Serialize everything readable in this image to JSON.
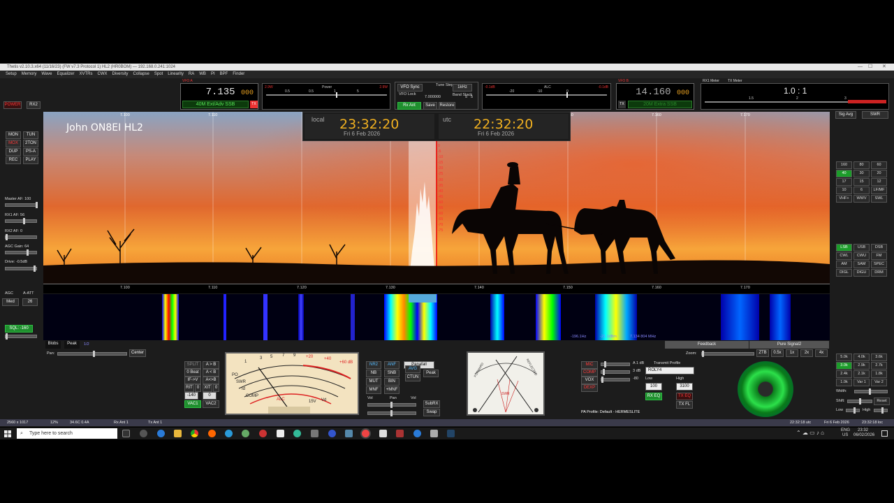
{
  "window": {
    "title": "Thetis v2.10.3.x64 (11/16/23) (FW v7.3 Protocol 1) HL2 (HR0BOM) — 192.168.0.241:1024"
  },
  "menu": [
    "Setup",
    "Memory",
    "Wave",
    "Equalizer",
    "XVTRs",
    "CWX",
    "Diversity",
    "Collapse",
    "Spot",
    "Linearity",
    "RA",
    "WB",
    "PI",
    "BPF",
    "Finder"
  ],
  "left_buttons": {
    "power": "POWER",
    "rx2": "RX2",
    "mon": "MON",
    "tun": "TUN",
    "mox": "MOX",
    "two_ton": "2TON",
    "dup": "DUP",
    "ps_a": "PS-A",
    "rec": "REC",
    "play": "PLAY"
  },
  "left_sliders": {
    "master_af": "Master AF: 100",
    "rx1_af": "RX1 AF: 56",
    "rx2_af": "RX2 AF: 0",
    "agc_gain": "AGC Gain: 64",
    "drive": "Drive: -0.5dB",
    "agc": "AGC",
    "a_att": "A-ATT",
    "agc_mode": "Med",
    "att": "26",
    "sql": "SQL: -160"
  },
  "vfo_a": {
    "label": "VFO A",
    "freq": "7.135",
    "freq_small": "000",
    "band": "40M Ext/Adv SSB",
    "tx": "TX"
  },
  "vfo_b": {
    "label": "VFO B",
    "freq": "14.160",
    "freq_small": "000",
    "band": "20M Extra SSB",
    "tx": "TX"
  },
  "power_meter": {
    "left": "2.9W",
    "title": "Power",
    "right": "2.9W",
    "scale": [
      "0.5",
      "0.5",
      "1",
      "5"
    ]
  },
  "alc_meter": {
    "left": "-0.1dB",
    "title": "ALC",
    "right": "-0.1dB",
    "scale": [
      "-20",
      "-10",
      "0"
    ]
  },
  "sync": {
    "vfo_sync": "VFO Sync",
    "vfo_lock": "VFO Lock",
    "tune_step": "Tune Step:",
    "step": "1kHz",
    "band_stack": "Band Stack",
    "stack_val": "7.000000",
    "rx_ant": "Rx Ant",
    "save": "Save",
    "restore": "Restore",
    "num": "5",
    "num2": "5"
  },
  "rx_meter": {
    "rx1": "RX1 Meter",
    "tx": "TX Meter",
    "value": "1.0 : 1",
    "scale": [
      "1.5",
      "2",
      "3"
    ],
    "sig_avg": "Sig Avg",
    "swr": "SWR"
  },
  "callsign": "John ON8EI HL2",
  "clocks": {
    "local_label": "local",
    "local_time": "23:32:20",
    "local_date": "Fri 6 Feb 2026",
    "utc_label": "utc",
    "utc_time": "22:32:20",
    "utc_date": "Fri 6 Feb 2026"
  },
  "freq_ticks_top": [
    "7.100",
    "7.110",
    "7.120",
    "7.130",
    "7.140",
    "7.150",
    "7.160",
    "7.170"
  ],
  "freq_ticks_bottom": [
    "7.100",
    "7.110",
    "7.120",
    "7.130",
    "7.140",
    "7.150",
    "7.160",
    "7.170"
  ],
  "db_scale": [
    "0",
    "-5",
    "-10",
    "-15",
    "-20",
    "-25",
    "-30",
    "-35",
    "-40",
    "-45",
    "-50",
    "-55",
    "-60",
    "-65",
    "-70",
    "-75"
  ],
  "wf_status": {
    "hz": "-196.1Hz",
    "dbm": "-21.1dBm",
    "mhz": "7.134 804 MHz"
  },
  "bottom_tabs": {
    "blobs": "Blobs",
    "peak": "Peak",
    "half": "1/2",
    "feedback": "Feedback",
    "pure": "Pure Signal2",
    "zoom": "Zoom:",
    "pan": "Pan:",
    "center": "Center"
  },
  "zoom_buttons": [
    "ZTB",
    "0.5x",
    "1x",
    "2x",
    "4x"
  ],
  "bands": [
    "160",
    "80",
    "60",
    "40",
    "30",
    "20",
    "17",
    "15",
    "12",
    "10",
    "6",
    "LF/MF",
    "VHF+",
    "WWV",
    "SWL"
  ],
  "modes": [
    "LSB",
    "USB",
    "DSB",
    "CWL",
    "CWU",
    "FM",
    "AM",
    "SAM",
    "SPEC",
    "DIGL",
    "DIGU",
    "DRM"
  ],
  "filters": [
    "5.0k",
    "4.0k",
    "3.6k",
    "3.0k",
    "2.9k",
    "2.7k",
    "2.4k",
    "2.1k",
    "1.8k",
    "1.0k",
    "Var 1",
    "Var 2"
  ],
  "filter_labels": {
    "width": "Width:",
    "shift": "Shift:",
    "reset": "Reset",
    "low": "Low",
    "high": "High"
  },
  "split_panel": [
    "SPLIT",
    "A > B",
    "0 Beat",
    "A < B",
    "IF->V",
    "A<>B",
    "RIT",
    "0",
    "XIT",
    "0",
    "-140",
    "0",
    "VAC1",
    "VAC2"
  ],
  "dsp": {
    "nr2": "NR2",
    "anf": "ANF",
    "nb": "NB",
    "snb": "SNB",
    "mut": "MUT",
    "bin": "BIN",
    "mnf": "MNF",
    "plus_mnf": "+MNF",
    "avg": "AVG",
    "ctun": "CTUN",
    "display": "Panafall",
    "peak": "Peak",
    "vol": "Vol",
    "pan": "Pan",
    "subrx": "SubRX",
    "swap": "Swap"
  },
  "analog_meter": {
    "scale_top": [
      "1",
      "3",
      "5",
      "7",
      "9",
      "+20",
      "+40",
      "+60 dB"
    ],
    "labels": [
      "SWR",
      "Id",
      "PO",
      "COMP",
      "ALC",
      "15V",
      "Vd"
    ]
  },
  "swr_meter": {
    "forward": "FORWARD",
    "reflected": "REFLECTED",
    "swr": "SWR"
  },
  "tx_panel": {
    "mic": "MIC",
    "comp": "COMP",
    "vox": "VOX",
    "dexp": "DEXP",
    "mic_db": "A 1 dB",
    "comp_db": "3 dB",
    "vox_db": "-80",
    "transmit_profile": "Transmit Profile",
    "profile": "ROLY4",
    "low": "Low",
    "high": "High",
    "low_val": "100",
    "high_val": "3100",
    "rx_eq": "RX EQ",
    "tx_eq": "TX EQ",
    "tx_fl": "TX FL",
    "pa_profile": "PA Profile: Default - HERMESLITE"
  },
  "status_bar": {
    "resolution": "2560 x 1017",
    "cpu": "12%",
    "volt": "34.6C  0.4A",
    "rx_ant": "Rx Ant 1",
    "tx_ant": "Tx Ant 1",
    "utc": "22:32:18 utc",
    "date": "Fri 6 Feb 2026",
    "loc": "23:32:18 loc"
  },
  "taskbar": {
    "search": "Type here to search",
    "lang": "ENG",
    "region": "US",
    "time": "23:32",
    "date": "06/02/2026"
  }
}
